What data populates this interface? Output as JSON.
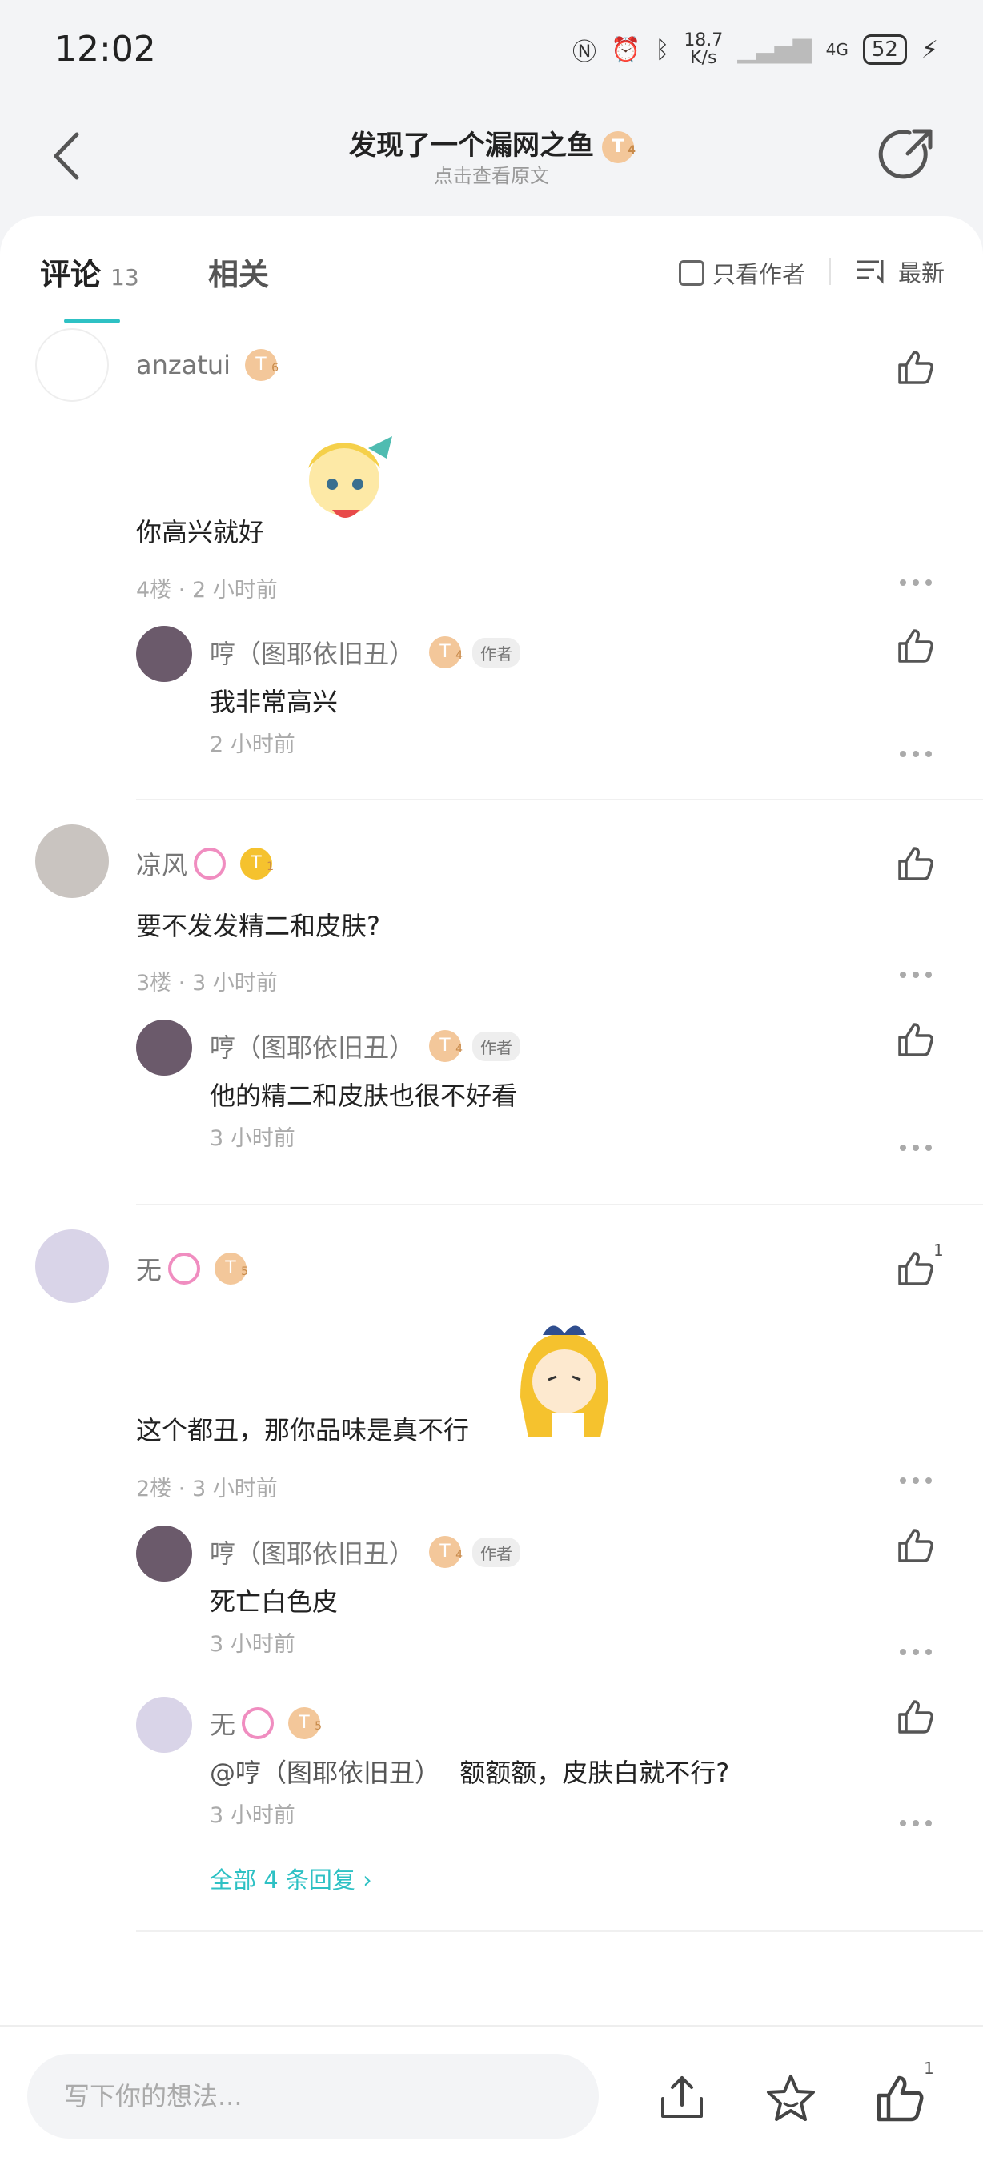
{
  "status": {
    "time": "12:02",
    "speed": "18.7",
    "speed_unit": "K/s",
    "network": "4G",
    "battery": "52"
  },
  "header": {
    "title": "发现了一个漏网之鱼",
    "subtitle": "点击查看原文",
    "title_badge": "T"
  },
  "tabs": {
    "comments_label": "评论",
    "comments_count": "13",
    "related_label": "相关",
    "only_author": "只看作者",
    "sort": "最新"
  },
  "comments": [
    {
      "user": "anzatui",
      "badge": "T",
      "text": "你高兴就好",
      "floor": "4楼",
      "time": "2 小时前",
      "replies": [
        {
          "user": "哼（图耶依旧丑）",
          "badge": "T",
          "tag": "作者",
          "text": "我非常高兴",
          "time": "2 小时前"
        }
      ]
    },
    {
      "user": "凉风",
      "badge": "T",
      "text": "要不发发精二和皮肤?",
      "floor": "3楼",
      "time": "3 小时前",
      "replies": [
        {
          "user": "哼（图耶依旧丑）",
          "badge": "T",
          "tag": "作者",
          "text": "他的精二和皮肤也很不好看",
          "time": "3 小时前"
        }
      ]
    },
    {
      "user": "无",
      "badge": "T",
      "text": "这个都丑，那你品味是真不行",
      "floor": "2楼",
      "time": "3 小时前",
      "likes": "1",
      "replies": [
        {
          "user": "哼（图耶依旧丑）",
          "badge": "T",
          "tag": "作者",
          "text": "死亡白色皮",
          "time": "3 小时前"
        },
        {
          "user": "无",
          "badge": "T",
          "mention": "@哼（图耶依旧丑）",
          "text": "额额额，皮肤白就不行?",
          "time": "3 小时前"
        }
      ],
      "expand": "全部 4 条回复 ›"
    }
  ],
  "bottom": {
    "placeholder": "写下你的想法...",
    "like_count": "1"
  },
  "colors": {
    "accent": "#2ec1c4",
    "badge": "#f3c79a"
  }
}
